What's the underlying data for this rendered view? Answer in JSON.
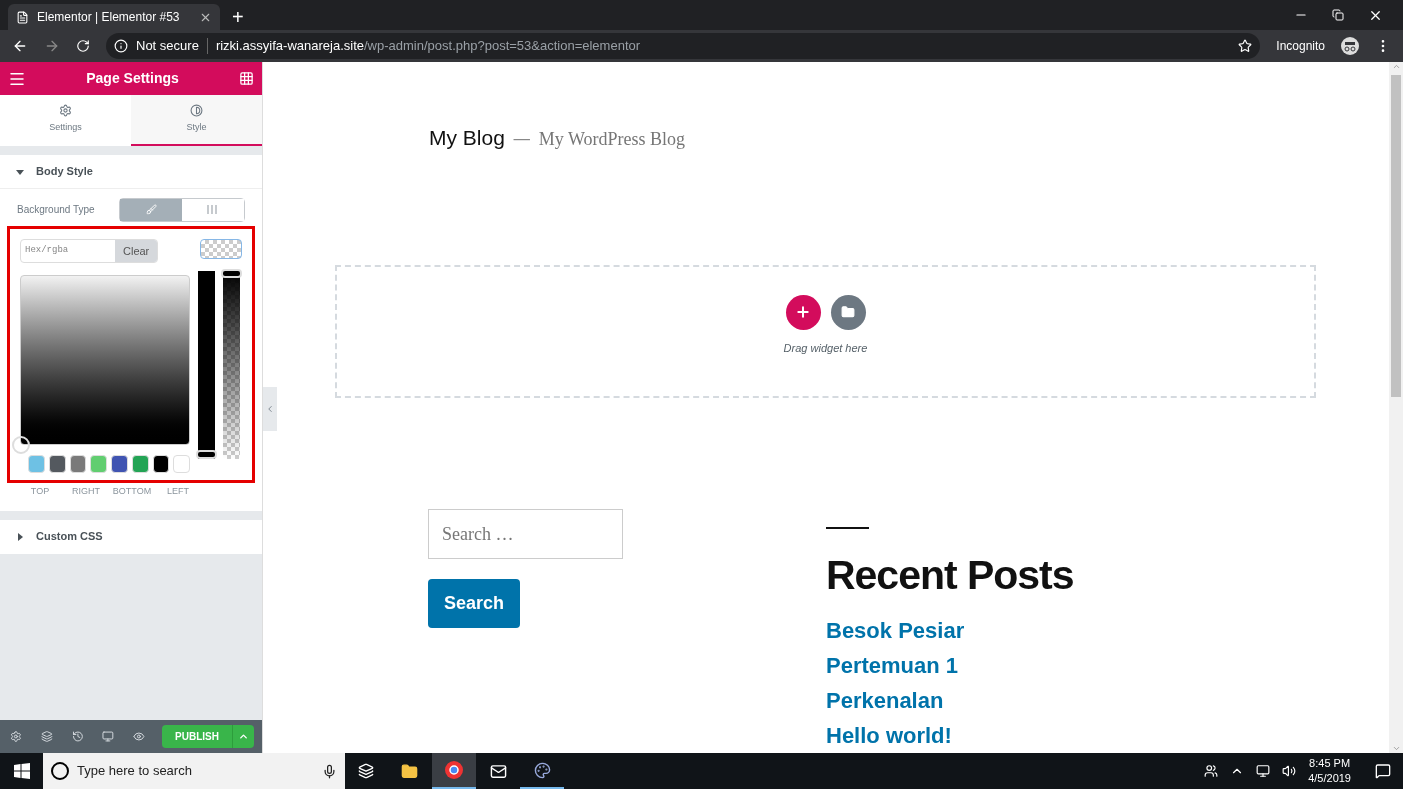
{
  "browser": {
    "tab_title": "Elementor | Elementor #53",
    "new_tab": "+",
    "security": "Not secure",
    "url_host": "rizki.assyifa-wanareja.site",
    "url_path": "/wp-admin/post.php?post=53&action=elementor",
    "profile": "Incognito"
  },
  "panel": {
    "title": "Page Settings",
    "tabs": [
      {
        "label": "Settings",
        "selected": false
      },
      {
        "label": "Style",
        "selected": true
      }
    ],
    "body_section": {
      "title": "Body Style",
      "expanded": true
    },
    "background_type": {
      "label": "Background Type",
      "options": [
        {
          "kind": "classic",
          "selected": true
        },
        {
          "kind": "gradient",
          "selected": false
        }
      ]
    },
    "color_picker": {
      "placeholder": "Hex/rgba",
      "clear": "Clear",
      "hue_slider": {
        "level": 0
      },
      "alpha_slider": {
        "level": 1
      },
      "swatches": [
        {
          "color": "#6ec1e4"
        },
        {
          "color": "#54595f"
        },
        {
          "color": "#7a7a7a"
        },
        {
          "color": "#61ce70"
        },
        {
          "color": "#4054b2"
        },
        {
          "color": "#23a455"
        },
        {
          "color": "#000000"
        },
        {
          "color": "#ffffff"
        }
      ]
    },
    "dimension_labels": [
      "TOP",
      "RIGHT",
      "BOTTOM",
      "LEFT"
    ],
    "css_section": {
      "title": "Custom CSS",
      "expanded": false
    },
    "publish": "PUBLISH"
  },
  "canvas": {
    "site_title": "My Blog",
    "separator": "—",
    "tagline": "My WordPress Blog",
    "drop_hint": "Drag widget here",
    "search_placeholder": "Search …",
    "search_button": "Search",
    "recent_heading": "Recent Posts",
    "posts": [
      "Besok Pesiar",
      "Pertemuan 1",
      "Perkenalan",
      "Hello world!"
    ]
  },
  "taskbar": {
    "search_placeholder": "Type here to search",
    "time": "8:45 PM",
    "date": "4/5/2019"
  }
}
